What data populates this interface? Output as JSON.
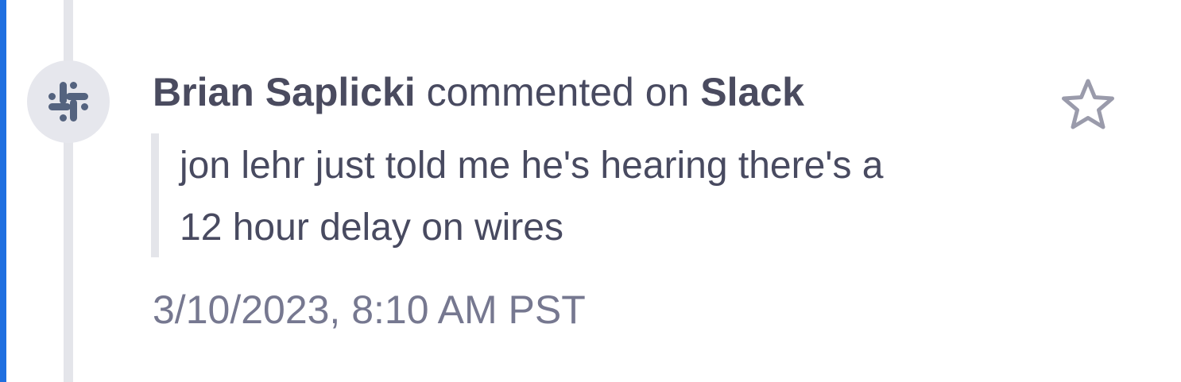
{
  "activity": {
    "author": "Brian Saplicki",
    "action": " commented on ",
    "source": "Slack",
    "message_line1": "jon lehr just told me he's hearing there's a",
    "message_line2": "12 hour delay on wires",
    "timestamp": "3/10/2023, 8:10 AM PST",
    "avatar_icon": "slack-icon",
    "star_icon": "star-outline-icon"
  },
  "colors": {
    "accent_border": "#1f6fe0",
    "timeline": "#e4e5ea",
    "avatar_bg": "#e6e7ed",
    "icon": "#54637f",
    "text": "#484a60",
    "muted": "#767890",
    "star": "#9a9bab"
  }
}
